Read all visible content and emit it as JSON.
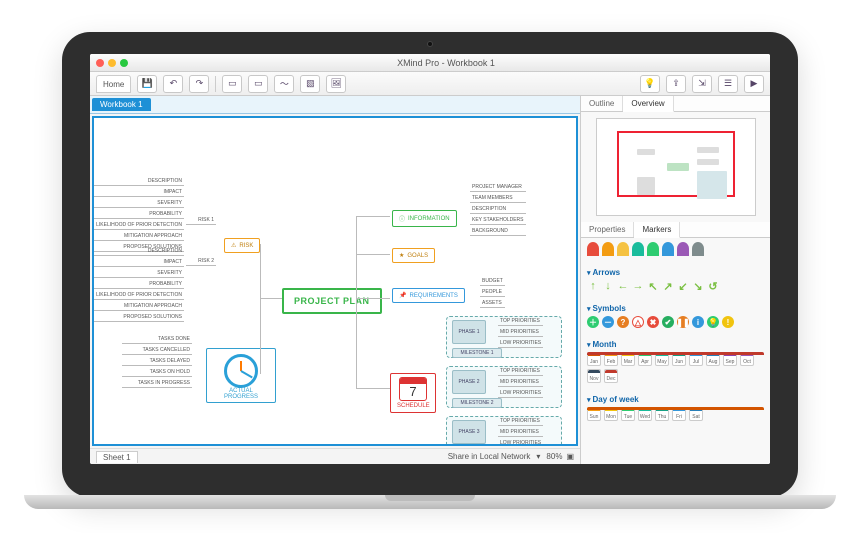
{
  "window": {
    "title": "XMind Pro - Workbook 1"
  },
  "toolbar": {
    "home": "Home"
  },
  "tabs": {
    "document": "Workbook 1",
    "sheet": "Sheet 1"
  },
  "status": {
    "share": "Share in Local Network",
    "zoom": "80%"
  },
  "side": {
    "outline_tab": "Outline",
    "overview_tab": "Overview",
    "properties_tab": "Properties",
    "markers_tab": "Markers",
    "sections": {
      "arrows": "Arrows",
      "symbols": "Symbols",
      "month": "Month",
      "dow": "Day of week"
    },
    "months": [
      "Jan",
      "Feb",
      "Mar",
      "Apr",
      "May",
      "Jun",
      "Jul",
      "Aug",
      "Sep",
      "Oct",
      "Nov",
      "Dec"
    ],
    "dow": [
      "Sun",
      "Mon",
      "Tue",
      "Wed",
      "Thu",
      "Fri",
      "Sat"
    ]
  },
  "map": {
    "central": "PROJECT PLAN",
    "topics": {
      "risk": "RISK",
      "actual": "ACTUAL PROGRESS",
      "information": "INFORMATION",
      "goals": "GOALS",
      "requirements": "REQUIREMENTS",
      "schedule": "SCHEDULE",
      "cal_day": "7"
    },
    "risk_children": [
      "RISK 1",
      "RISK 2"
    ],
    "risk_details": [
      "DESCRIPTION",
      "IMPACT",
      "SEVERITY",
      "PROBABILITY",
      "LIKELIHOOD OF PRIOR DETECTION",
      "MITIGATION APPROACH",
      "PROPOSED SOLUTIONS"
    ],
    "actual_children": [
      "TASKS DONE",
      "TASKS CANCELLED",
      "TASKS DELAYED",
      "TASKS ON HOLD",
      "TASKS IN PROGRESS"
    ],
    "info_children": [
      "PROJECT MANAGER",
      "TEAM MEMBERS",
      "DESCRIPTION",
      "KEY STAKEHOLDERS",
      "BACKGROUND"
    ],
    "req_children": [
      "BUDGET",
      "PEOPLE",
      "ASSETS"
    ],
    "schedule_phases": [
      "PHASE 1",
      "PHASE 2",
      "PHASE 3"
    ],
    "schedule_milestones": [
      "MILESTONE 1",
      "MILESTONE 2"
    ],
    "priority_labels": [
      "TOP PRIORITIES",
      "MID PRIORITIES",
      "LOW PRIORITIES"
    ]
  }
}
